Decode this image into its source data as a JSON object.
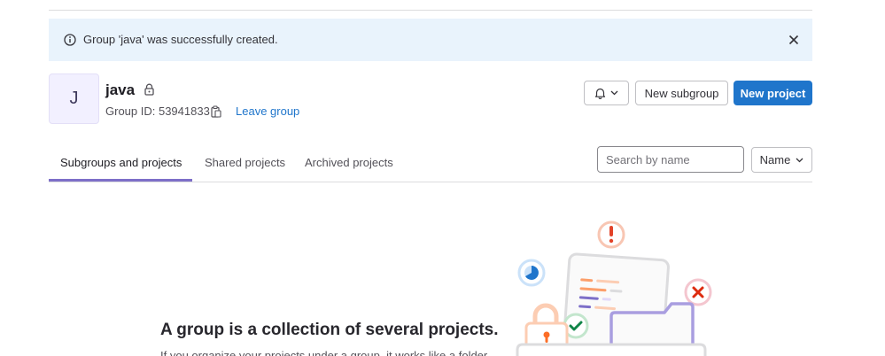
{
  "alert": {
    "message": "Group 'java' was successfully created.",
    "info_icon": "info-circle-icon",
    "close_icon": "close-icon"
  },
  "group": {
    "avatar_letter": "J",
    "name": "java",
    "visibility_icon": "lock-icon",
    "id_text": "Group ID: 53941833",
    "copy_icon": "copy-to-clipboard-icon",
    "leave_label": "Leave group"
  },
  "actions": {
    "notification_icon": "bell-icon",
    "new_subgroup_label": "New subgroup",
    "new_project_label": "New project"
  },
  "tabs": [
    {
      "label": "Subgroups and projects",
      "active": true
    },
    {
      "label": "Shared projects",
      "active": false
    },
    {
      "label": "Archived projects",
      "active": false
    }
  ],
  "search": {
    "placeholder": "Search by name",
    "value": ""
  },
  "sort": {
    "label": "Name"
  },
  "empty_state": {
    "title": "A group is a collection of several projects.",
    "description": "If you organize your projects under a group, it works like a folder"
  },
  "colors": {
    "primary": "#1f75cb",
    "alert_bg": "#e9f3fc",
    "tab_indicator": "#7d6fc8",
    "avatar_bg": "#f2f0ff"
  }
}
